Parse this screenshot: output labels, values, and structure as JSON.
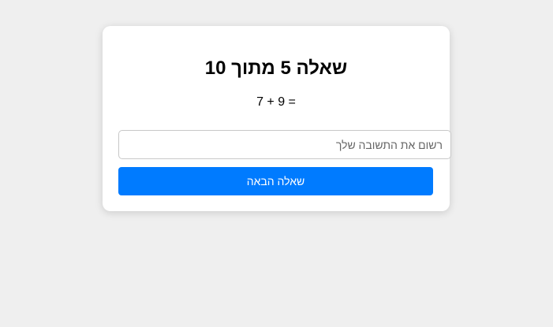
{
  "quiz": {
    "title": "שאלה 5 מתוך 10",
    "question": "7 + 9 =",
    "answer_placeholder": "רשום את התשובה שלך",
    "answer_value": "",
    "next_button_label": "שאלה הבאה"
  },
  "colors": {
    "page_background": "#efefef",
    "card_background": "#ffffff",
    "button_accent": "#007bff"
  }
}
